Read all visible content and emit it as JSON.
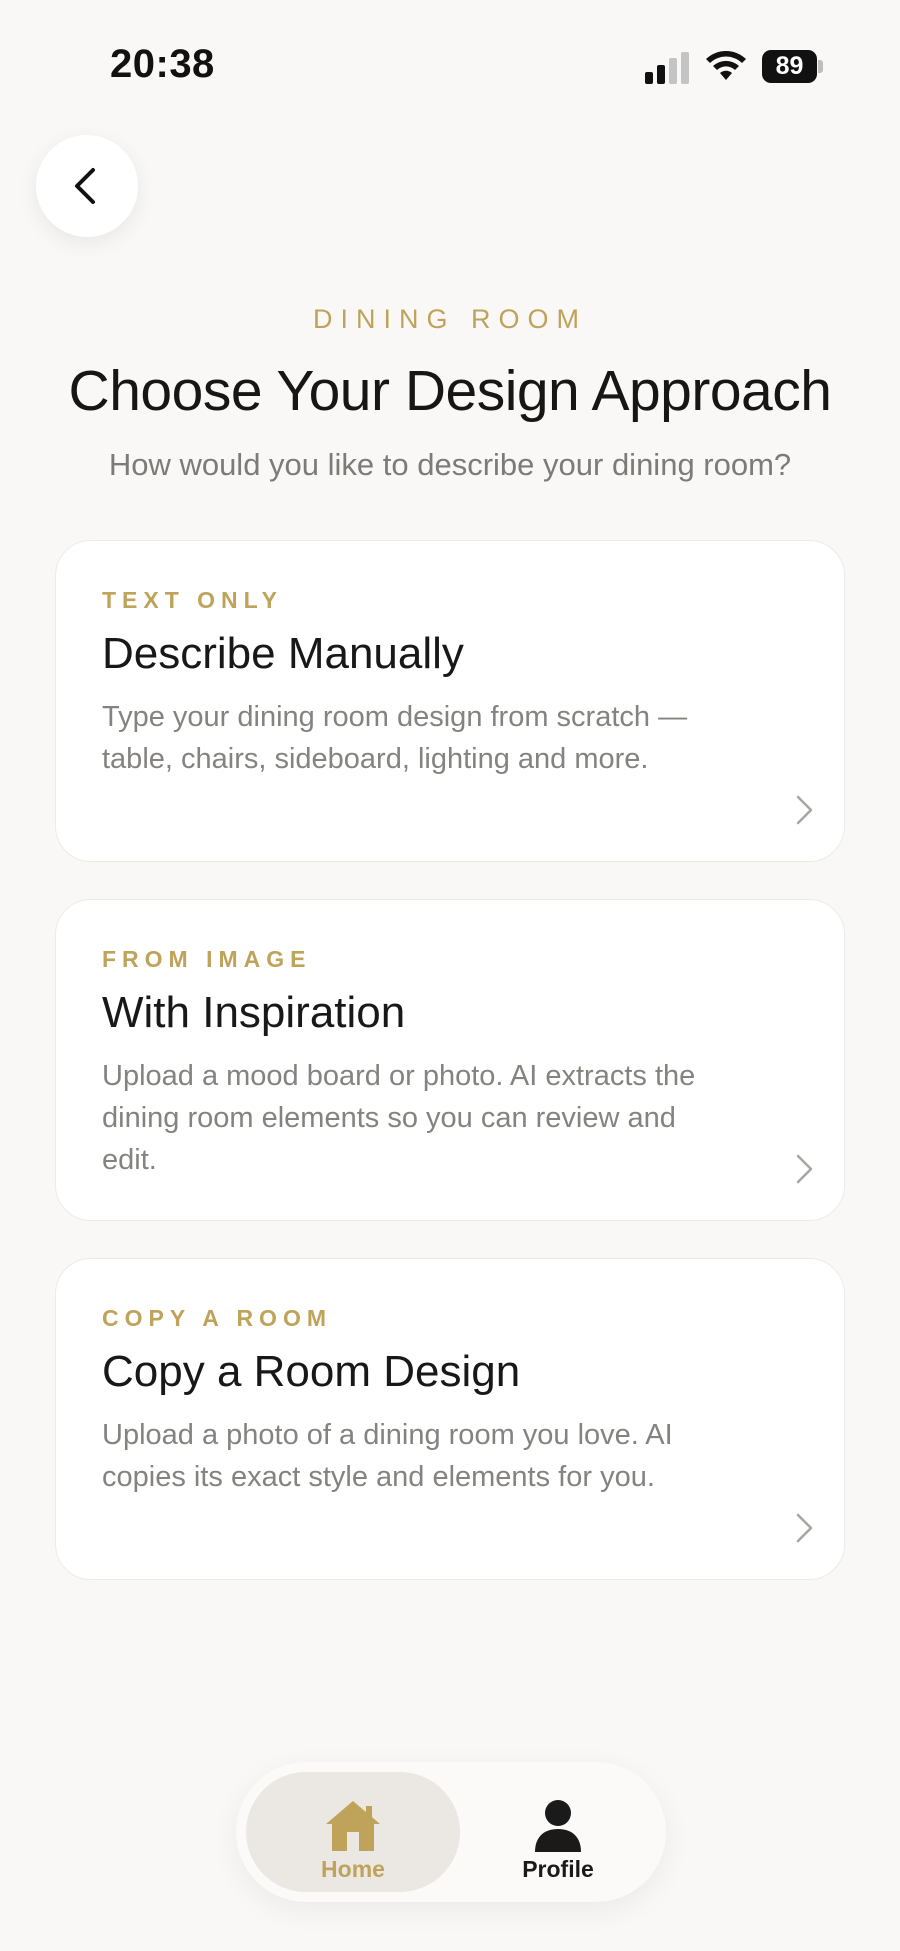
{
  "status_bar": {
    "time": "20:38",
    "battery": "89",
    "icons": [
      "signal-icon",
      "wifi-icon",
      "battery-icon"
    ]
  },
  "header": {
    "back_icon": "chevron-left-icon",
    "eyebrow": "DINING ROOM",
    "title": "Choose Your Design Approach",
    "subtitle": "How would you like to describe your dining room?"
  },
  "options": [
    {
      "tag": "TEXT ONLY",
      "title": "Describe Manually",
      "description": "Type your dining room design from scratch — table, chairs, sideboard, lighting and more.",
      "icon": "chevron-right-icon"
    },
    {
      "tag": "FROM IMAGE",
      "title": "With Inspiration",
      "description": "Upload a mood board or photo. AI extracts the dining room elements so you can review and edit.",
      "icon": "chevron-right-icon"
    },
    {
      "tag": "COPY A ROOM",
      "title": "Copy a Room Design",
      "description": "Upload a photo of a dining room you love. AI copies its exact style and elements for you.",
      "icon": "chevron-right-icon"
    }
  ],
  "tab_bar": {
    "active": "Home",
    "items": [
      {
        "label": "Home",
        "icon": "house-icon"
      },
      {
        "label": "Profile",
        "icon": "person-icon"
      }
    ]
  },
  "colors": {
    "accent": "#bfa35a",
    "background": "#f9f8f6",
    "card": "#ffffff",
    "muted_text": "#858380"
  }
}
